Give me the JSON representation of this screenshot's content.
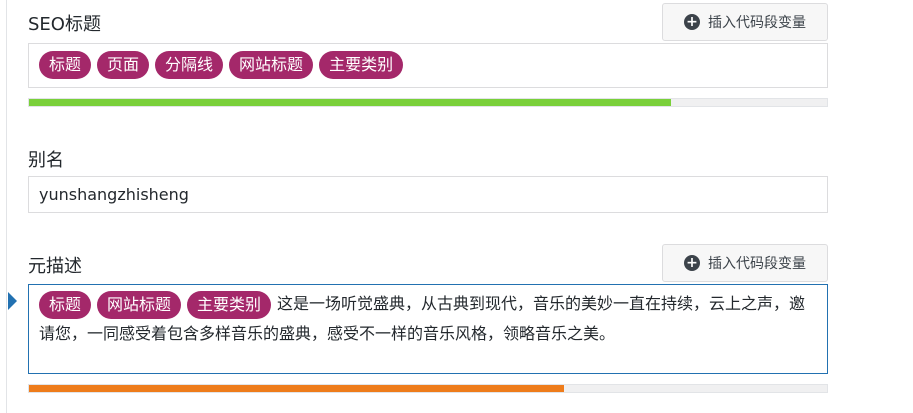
{
  "seo_title": {
    "label": "SEO标题",
    "insert_button": "插入代码段变量",
    "tags": [
      "标题",
      "页面",
      "分隔线",
      "网站标题",
      "主要类别"
    ],
    "progress": 0.805,
    "progress_color": "#7ad03a"
  },
  "slug": {
    "label": "别名",
    "value": "yunshangzhisheng"
  },
  "meta_description": {
    "label": "元描述",
    "insert_button": "插入代码段变量",
    "tags": [
      "标题",
      "网站标题",
      "主要类别"
    ],
    "text": "这是一场听觉盛典，从古典到现代，音乐的美妙一直在持续，云上之声，邀请您，一同感受着包含多样音乐的盛典，感受不一样的音乐风格，领略音乐之美。",
    "progress": 0.67,
    "progress_color": "#ee7c1b"
  },
  "colors": {
    "tag_background": "#a4286a",
    "focus_border": "#2271b1"
  },
  "icons": {
    "insert": "plus-circle-icon",
    "focus_indicator": "triangle-right-icon"
  }
}
